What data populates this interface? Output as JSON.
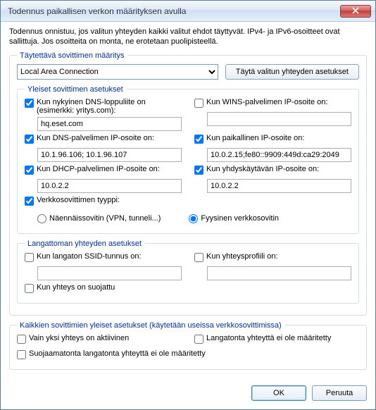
{
  "window": {
    "title": "Todennus paikallisen verkon määrityksen avulla"
  },
  "description": "Todennus onnistuu, jos valitun yhteyden kaikki valitut ehdot täyttyvät. IPv4- ja IPv6-osoitteet ovat sallittuja. Jos osoitteita on monta, ne erotetaan puolipisteellä.",
  "adapter_group_label": "Täytettävä sovittimen määritys",
  "adapter_select": {
    "value": "Local Area Connection"
  },
  "fill_button": "Täytä valitun yhteyden asetukset",
  "general_group_label": "Yleiset sovittimen asetukset",
  "fields": {
    "dns_suffix": {
      "checked": true,
      "label": "Kun nykyinen DNS-loppuliite on (esimerkki: yritys.com):",
      "value": "hq.eset.com"
    },
    "wins_ip": {
      "checked": false,
      "label": "Kun WINS-palvelimen IP-osoite on:",
      "value": ""
    },
    "dns_ip": {
      "checked": true,
      "label": "Kun DNS-palvelimen IP-osoite on:",
      "value": "10.1.96.106; 10.1.96.107"
    },
    "local_ip": {
      "checked": true,
      "label": "Kun paikallinen IP-osoite on:",
      "value": "10.0.2.15;fe80::9909:449d:ca29:2049"
    },
    "dhcp_ip": {
      "checked": true,
      "label": "Kun DHCP-palvelimen IP-osoite on:",
      "value": "10.0.2.2"
    },
    "gateway_ip": {
      "checked": true,
      "label": "Kun yhdyskäytävän IP-osoite on:",
      "value": "10.0.2.2"
    },
    "adapter_type": {
      "checked": true,
      "label": "Verkkosovittimen tyyppi:"
    }
  },
  "adapter_type_options": {
    "virtual": "Näennäissovitin (VPN, tunneli...)",
    "physical": "Fyysinen verkkosovitin",
    "selected": "physical"
  },
  "wireless_group_label": "Langattoman yhteyden asetukset",
  "wireless": {
    "ssid": {
      "checked": false,
      "label": "Kun langaton SSID-tunnus on:",
      "value": ""
    },
    "profile": {
      "checked": false,
      "label": "Kun yhteysprofiili on:",
      "value": ""
    },
    "secured": {
      "checked": false,
      "label": "Kun yhteys on suojattu"
    }
  },
  "global_group_label": "Kaikkien sovittimien yleiset asetukset (käytetään useissa verkkosovittimissa)",
  "global": {
    "only_one_active": {
      "checked": false,
      "label": "Vain yksi yhteys on aktiivinen"
    },
    "no_wireless": {
      "checked": false,
      "label": "Langatonta yhteyttä ei ole määritetty"
    },
    "no_unsecured_wifi": {
      "checked": false,
      "label": "Suojaamatonta langatonta yhteyttä ei ole määritetty"
    }
  },
  "buttons": {
    "ok": "OK",
    "cancel": "Peruuta"
  }
}
